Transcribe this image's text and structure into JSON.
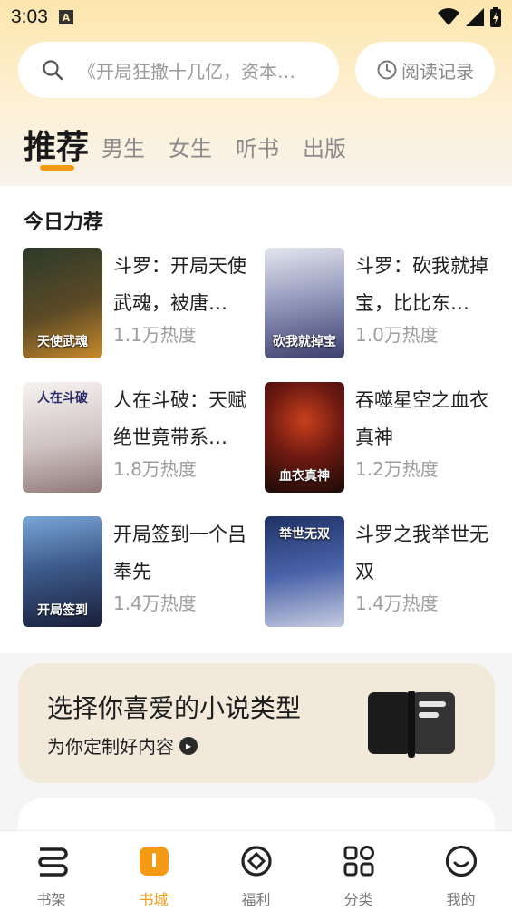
{
  "status_bar": {
    "time": "3:03",
    "indicator": "A"
  },
  "search": {
    "placeholder": "《开局狂撒十几亿，资本…"
  },
  "history_button": {
    "label": "阅读记录"
  },
  "tabs": [
    {
      "label": "推荐",
      "active": true
    },
    {
      "label": "男生"
    },
    {
      "label": "女生"
    },
    {
      "label": "听书"
    },
    {
      "label": "出版"
    }
  ],
  "section": {
    "title": "今日力荐",
    "books": [
      {
        "title": "斗罗：开局天使武魂，被唐…",
        "heat": "1.1万热度",
        "cover_text": "天使武魂",
        "cover_colors": [
          "#2b3a2a",
          "#c98a2a"
        ]
      },
      {
        "title": "斗罗：砍我就掉宝，比比东…",
        "heat": "1.0万热度",
        "cover_text": "砍我就掉宝",
        "cover_colors": [
          "#d9dce6",
          "#4a4f7a"
        ]
      },
      {
        "title": "人在斗破：天赋绝世竟带系…",
        "heat": "1.8万热度",
        "cover_text": "人在斗破",
        "cover_colors": [
          "#f4f1ee",
          "#8f7a7a"
        ]
      },
      {
        "title": "吞噬星空之血衣真神",
        "heat": "1.2万热度",
        "cover_text": "血衣真神",
        "cover_colors": [
          "#6e1a12",
          "#1b0a08"
        ]
      },
      {
        "title": "开局签到一个吕奉先",
        "heat": "1.4万热度",
        "cover_text": "开局签到",
        "cover_colors": [
          "#3d5b8c",
          "#1a1f3b"
        ]
      },
      {
        "title": "斗罗之我举世无双",
        "heat": "1.4万热度",
        "cover_text": "举世无双",
        "cover_colors": [
          "#2a3f7a",
          "#c6cbe0"
        ]
      }
    ]
  },
  "genre_card": {
    "title": "选择你喜爱的小说类型",
    "subtitle": "为你定制好内容"
  },
  "bottom_nav": [
    {
      "label": "书架",
      "icon": "bookshelf-icon"
    },
    {
      "label": "书城",
      "icon": "bookstore-icon",
      "active": true
    },
    {
      "label": "福利",
      "icon": "welfare-icon"
    },
    {
      "label": "分类",
      "icon": "category-icon"
    },
    {
      "label": "我的",
      "icon": "profile-icon"
    }
  ],
  "colors": {
    "accent": "#f59a14"
  }
}
